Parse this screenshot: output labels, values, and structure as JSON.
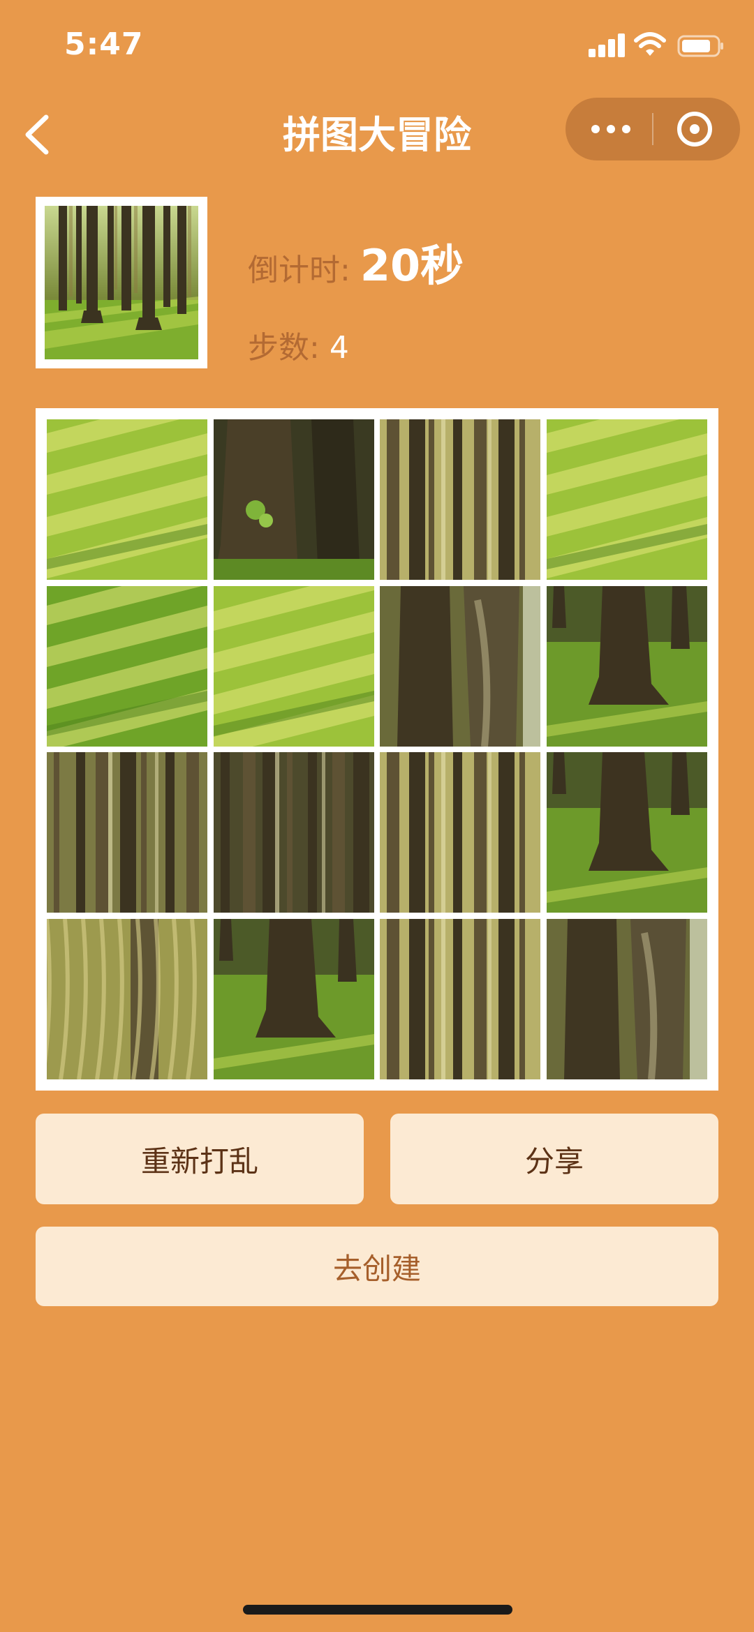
{
  "status_bar": {
    "time": "5:47",
    "icons": [
      "signal-icon",
      "wifi-icon",
      "battery-icon"
    ]
  },
  "nav": {
    "title": "拼图大冒险",
    "back_icon": "chevron-left-icon",
    "capsule_icons": [
      "more-icon",
      "close-icon"
    ]
  },
  "game": {
    "countdown_label": "倒计时:",
    "countdown_value": "20秒",
    "steps_label": "步数:",
    "steps_value": "4"
  },
  "puzzle": {
    "rows": 4,
    "cols": 4,
    "tiles": [
      {
        "kind": "grass-light"
      },
      {
        "kind": "trunk-dark"
      },
      {
        "kind": "forest-bright"
      },
      {
        "kind": "grass-light"
      },
      {
        "kind": "grass"
      },
      {
        "kind": "grass-light"
      },
      {
        "kind": "trunk-mid"
      },
      {
        "kind": "trunk-base"
      },
      {
        "kind": "forest-mid"
      },
      {
        "kind": "forest-dark"
      },
      {
        "kind": "forest-bright"
      },
      {
        "kind": "trunk-base"
      },
      {
        "kind": "moss"
      },
      {
        "kind": "trunk-base"
      },
      {
        "kind": "forest-bright"
      },
      {
        "kind": "trunk-mid"
      }
    ]
  },
  "buttons": {
    "reshuffle": "重新打乱",
    "share": "分享",
    "create": "去创建"
  },
  "colors": {
    "background": "#E8994B",
    "button_bg": "#FCEAD3",
    "label_muted": "#B36A33"
  }
}
